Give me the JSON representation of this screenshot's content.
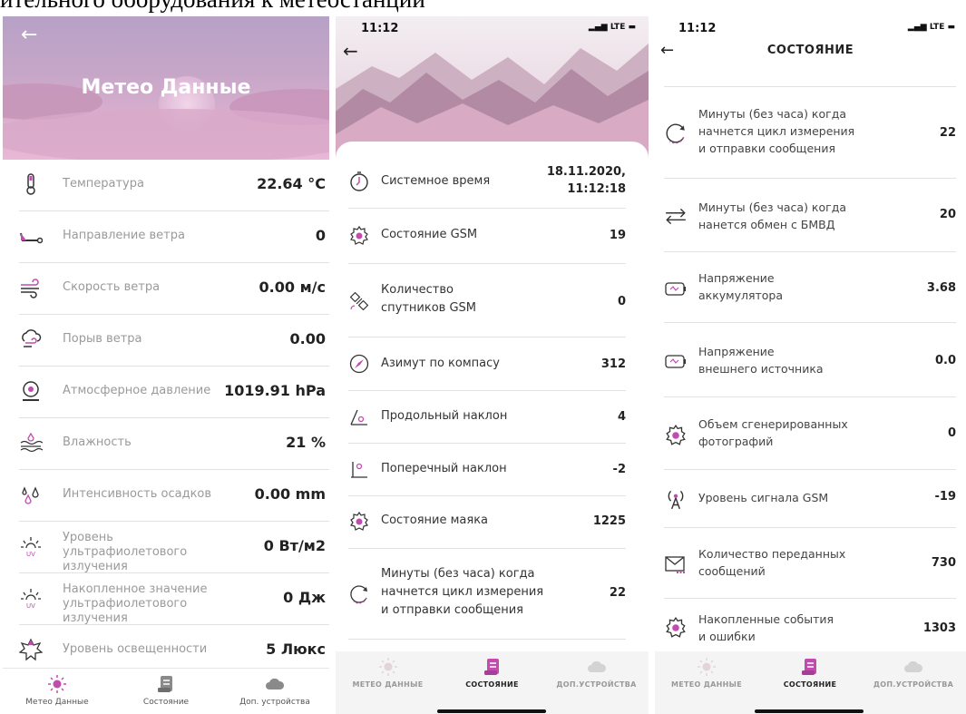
{
  "caption": "ительного оборудования к метеостанции",
  "screen1": {
    "title": "Метео Данные",
    "rows": [
      {
        "label": "Температура",
        "value": "22.64 °C",
        "icon": "thermometer-icon"
      },
      {
        "label": "Направление ветра",
        "value": "0",
        "icon": "wind-direction-icon"
      },
      {
        "label": "Скорость ветра",
        "value": "0.00 м/с",
        "icon": "wind-speed-icon"
      },
      {
        "label": "Порыв ветра",
        "value": "0.00",
        "icon": "wind-gust-icon"
      },
      {
        "label": "Атмосферное давление",
        "value": "1019.91 hPa",
        "icon": "pressure-gauge-icon"
      },
      {
        "label": "Влажность",
        "value": "21 %",
        "icon": "humidity-icon"
      },
      {
        "label": "Интенсивность осадков",
        "value": "0.00 mm",
        "icon": "rain-drops-icon"
      },
      {
        "label": "Уровень ультрафиолетового излучения",
        "value": "0 Вт/м2",
        "icon": "uv-icon"
      },
      {
        "label": "Накопленное значение ультрафиолетового излучения",
        "value": "0 Дж",
        "icon": "uv-accumulated-icon"
      },
      {
        "label": "Уровень освещенности",
        "value": "5 Люкс",
        "icon": "illumination-icon"
      }
    ],
    "nav": [
      {
        "label": "Метео Данные",
        "icon": "sun-icon"
      },
      {
        "label": "Состояние",
        "icon": "status-doc-icon"
      },
      {
        "label": "Доп. устройства",
        "icon": "cloud-icon"
      }
    ]
  },
  "screen2": {
    "time": "11:12",
    "signal": "LTE",
    "rows": [
      {
        "label": "Системное время",
        "value": "18.11.2020,",
        "value2": "11:12:18",
        "icon": "clock-icon"
      },
      {
        "label": "Состояние GSM",
        "value": "19",
        "icon": "gear-icon"
      },
      {
        "label": "Количество",
        "label2": "спутников GSM",
        "value": "0",
        "icon": "satellite-icon"
      },
      {
        "label": "Азимут по компасу",
        "value": "312",
        "icon": "compass-icon"
      },
      {
        "label": "Продольный наклон",
        "value": "4",
        "icon": "tilt-long-icon"
      },
      {
        "label": "Поперечный наклон",
        "value": "-2",
        "icon": "tilt-cross-icon"
      },
      {
        "label": "Состояние маяка",
        "value": "1225",
        "icon": "beacon-gear-icon"
      },
      {
        "label": "Минуты (без часа) когда",
        "label2": "начнется цикл измерения",
        "label3": "и отправки сообщения",
        "value": "22",
        "icon": "cycle-icon"
      }
    ],
    "nav": [
      {
        "label": "МЕТЕО ДАННЫЕ",
        "icon": "sun-icon"
      },
      {
        "label": "СОСТОЯНИЕ",
        "icon": "status-doc-icon"
      },
      {
        "label": "ДОП.УСТРОЙСТВА",
        "icon": "cloud-icon"
      }
    ]
  },
  "screen3": {
    "time": "11:12",
    "signal": "LTE",
    "title": "СОСТОЯНИЕ",
    "rows": [
      {
        "label": "Минуты (без часа) когда",
        "label2": "начнется цикл измерения",
        "label3": "и отправки сообщения",
        "value": "22",
        "icon": "cycle-icon"
      },
      {
        "label": "Минуты (без часа) когда",
        "label2": "нанется обмен с БМВД",
        "value": "20",
        "icon": "exchange-arrows-icon"
      },
      {
        "label": "Напряжение",
        "label2": "аккумулятора",
        "value": "3.68",
        "icon": "battery-icon"
      },
      {
        "label": "Напряжение",
        "label2": "внешнего источника",
        "value": "0.0",
        "icon": "external-power-icon"
      },
      {
        "label": "Объем сгенерированных",
        "label2": "фотографий",
        "value": "0",
        "icon": "gear-icon"
      },
      {
        "label": "Уровень сигнала GSM",
        "value": "-19",
        "icon": "antenna-icon"
      },
      {
        "label": "Количество переданных",
        "label2": "сообщений",
        "value": "730",
        "icon": "envelope-icon"
      },
      {
        "label": "Накопленные события",
        "label2": "и ошибки",
        "value": "1303",
        "icon": "events-gear-icon"
      }
    ],
    "nav": [
      {
        "label": "МЕТЕО ДАННЫЕ",
        "icon": "sun-icon"
      },
      {
        "label": "СОСТОЯНИЕ",
        "icon": "status-doc-icon"
      },
      {
        "label": "ДОП.УСТРОЙСТВА",
        "icon": "cloud-icon"
      }
    ]
  },
  "colors": {
    "accent": "#c24bb0",
    "nav_grey": "#8a8a8a",
    "hero_pink": "#dcb0cf"
  }
}
